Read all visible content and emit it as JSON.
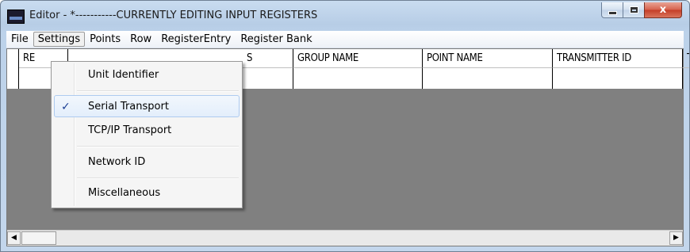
{
  "window": {
    "title": "Editor - *-----------CURRENTLY EDITING INPUT REGISTERS",
    "close_label": "x"
  },
  "menubar": {
    "items": [
      "File",
      "Settings",
      "Points",
      "Row",
      "RegisterEntry",
      "Register Bank"
    ],
    "active": "Settings"
  },
  "grid": {
    "columns": [
      "RE",
      "S",
      "GROUP NAME",
      "POINT NAME",
      "TRANSMITTER ID",
      "T"
    ]
  },
  "settings_menu": {
    "items": [
      {
        "label": "Unit Identifier",
        "checked": false
      },
      {
        "label": "Serial Transport",
        "checked": true,
        "highlighted": true
      },
      {
        "label": "TCP/IP Transport",
        "checked": false
      },
      {
        "label": "Network ID",
        "checked": false
      },
      {
        "label": "Miscellaneous",
        "checked": false
      }
    ],
    "check_glyph": "✓"
  },
  "scrollbar": {
    "left_arrow": "◀",
    "right_arrow": "▶"
  }
}
